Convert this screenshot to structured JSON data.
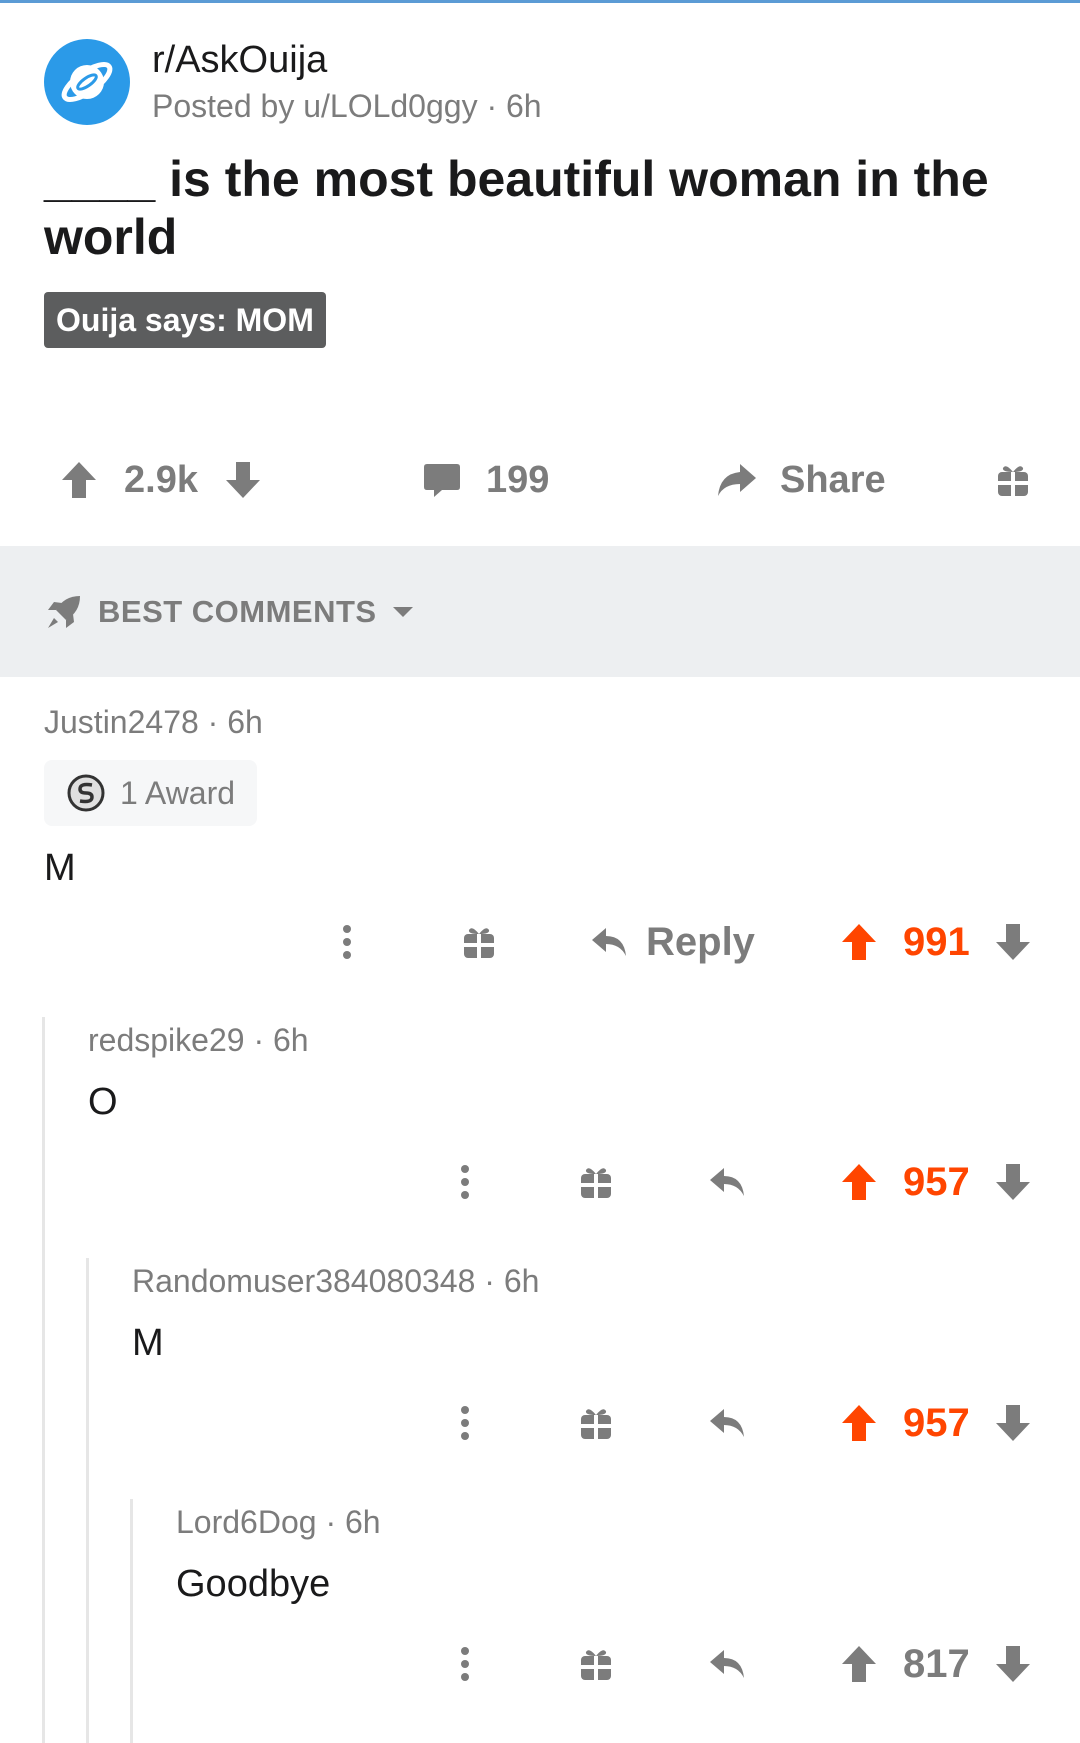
{
  "post": {
    "subreddit": "r/AskOuija",
    "posted_by": "Posted by u/LOLd0ggy · 6h",
    "title": "____ is the most beautiful woman in the world",
    "flair": "Ouija says: MOM",
    "upvotes": "2.9k",
    "comments": "199",
    "share_label": "Share"
  },
  "sort": {
    "label": "BEST COMMENTS"
  },
  "comments": [
    {
      "author": "Justin2478 · 6h",
      "award": "1 Award",
      "body": "M",
      "reply_label": "Reply",
      "votes": "991"
    },
    {
      "author": "redspike29 · 6h",
      "body": "O",
      "votes": "957"
    },
    {
      "author": "Randomuser384080348 · 6h",
      "body": "M",
      "votes": "957"
    },
    {
      "author": "Lord6Dog · 6h",
      "body": "Goodbye",
      "votes": "817"
    }
  ],
  "colors": {
    "upvoted": "#ff4500",
    "muted": "#7c7c7c",
    "subreddit_icon": "#2b9ae8",
    "flair_bg": "#5c5d5e"
  },
  "icons": [
    "planet-icon",
    "upvote-icon",
    "downvote-icon",
    "comment-icon",
    "share-icon",
    "gift-icon",
    "rocket-icon",
    "caret-down-icon",
    "silver-award-icon",
    "more-options-icon",
    "reply-icon"
  ]
}
